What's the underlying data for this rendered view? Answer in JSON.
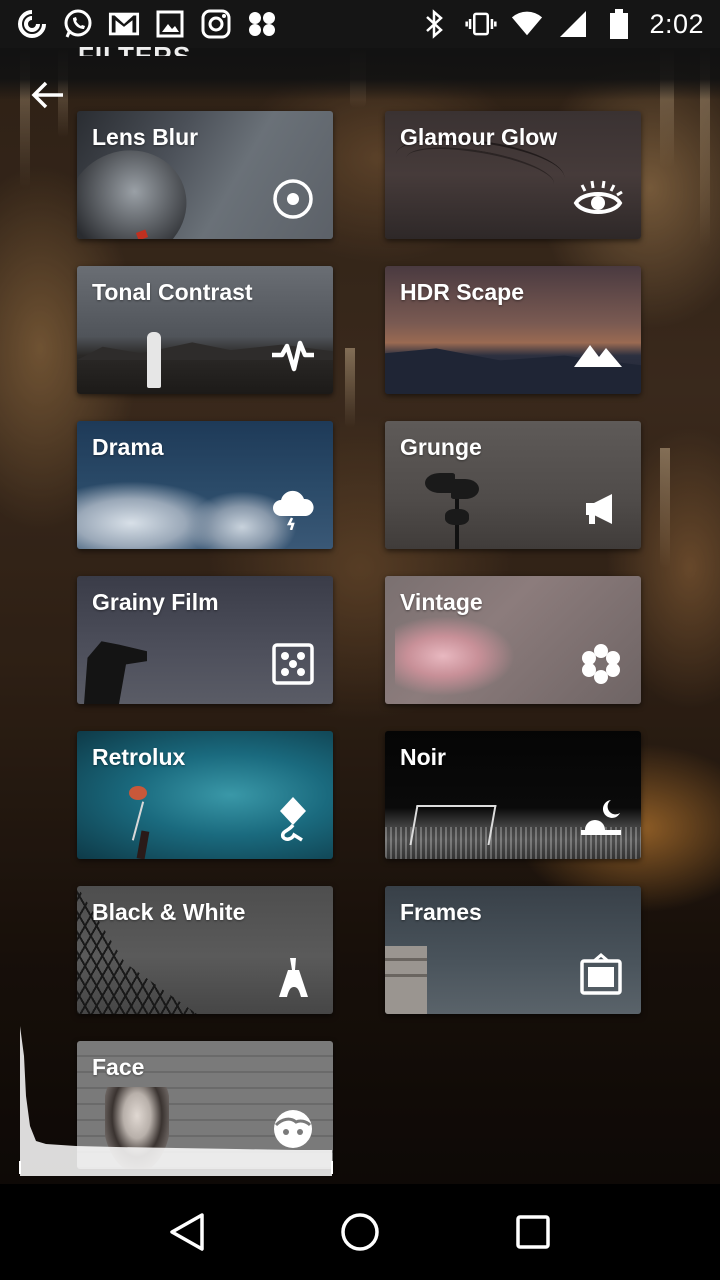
{
  "status_bar": {
    "time": "2:02",
    "left_icons": [
      "app-c-icon",
      "whatsapp-icon",
      "gmail-icon",
      "image-icon",
      "instagram-icon",
      "pinwheel-icon"
    ],
    "right_icons": [
      "bluetooth-icon",
      "vibrate-icon",
      "wifi-icon",
      "cell-signal-icon",
      "battery-icon"
    ]
  },
  "header": {
    "title": "FILTERS"
  },
  "filters": [
    {
      "label": "Lens Blur",
      "icon": "target-icon"
    },
    {
      "label": "Glamour Glow",
      "icon": "eye-icon"
    },
    {
      "label": "Tonal Contrast",
      "icon": "pulse-icon"
    },
    {
      "label": "HDR Scape",
      "icon": "mountains-icon"
    },
    {
      "label": "Drama",
      "icon": "storm-cloud-icon"
    },
    {
      "label": "Grunge",
      "icon": "megaphone-icon"
    },
    {
      "label": "Grainy Film",
      "icon": "dice-icon"
    },
    {
      "label": "Vintage",
      "icon": "flower-icon"
    },
    {
      "label": "Retrolux",
      "icon": "kite-icon"
    },
    {
      "label": "Noir",
      "icon": "moon-icon"
    },
    {
      "label": "Black & White",
      "icon": "eiffel-tower-icon"
    },
    {
      "label": "Frames",
      "icon": "frame-icon"
    },
    {
      "label": "Face",
      "icon": "face-icon"
    }
  ],
  "nav": {
    "buttons": [
      "back-triangle-icon",
      "home-circle-icon",
      "recents-square-icon"
    ]
  }
}
